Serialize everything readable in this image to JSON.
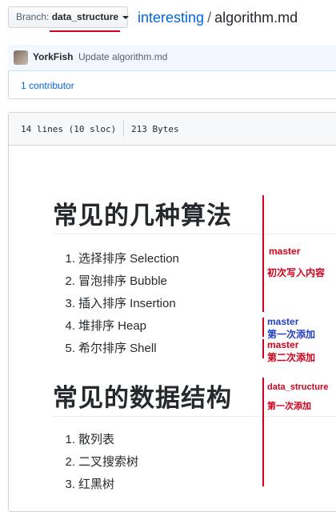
{
  "header": {
    "branch_label": "Branch:",
    "branch_value": "data_structure",
    "repo": "interesting",
    "separator": "/",
    "file": "algorithm.md"
  },
  "commit": {
    "author": "YorkFish",
    "message": "Update algorithm.md",
    "contributors_count": "1",
    "contributors_label": "contributor"
  },
  "file_info": {
    "lines": "14 lines (10 sloc)",
    "size": "213 Bytes"
  },
  "content": {
    "heading1": "常见的几种算法",
    "list1": [
      {
        "num": "1.",
        "text": "选择排序 Selection"
      },
      {
        "num": "2.",
        "text": "冒泡排序 Bubble"
      },
      {
        "num": "3.",
        "text": "插入排序 Insertion"
      },
      {
        "num": "4.",
        "text": "堆排序 Heap"
      },
      {
        "num": "5.",
        "text": "希尔排序 Shell"
      }
    ],
    "heading2": "常见的数据结构",
    "list2": [
      {
        "num": "1.",
        "text": "散列表"
      },
      {
        "num": "2.",
        "text": "二叉搜索树"
      },
      {
        "num": "3.",
        "text": "红黑树"
      }
    ]
  },
  "annotations": {
    "a1_branch": "master",
    "a1_note": "初次写入内容",
    "a2_branch": "master",
    "a2_note": "第一次添加",
    "a3_branch": "master",
    "a3_note": "第二次添加",
    "a4_branch": "data_structure",
    "a4_note": "第一次添加",
    "colors": {
      "red": "#d0021b",
      "blue": "#2240c8",
      "link": "#0366d6"
    }
  }
}
